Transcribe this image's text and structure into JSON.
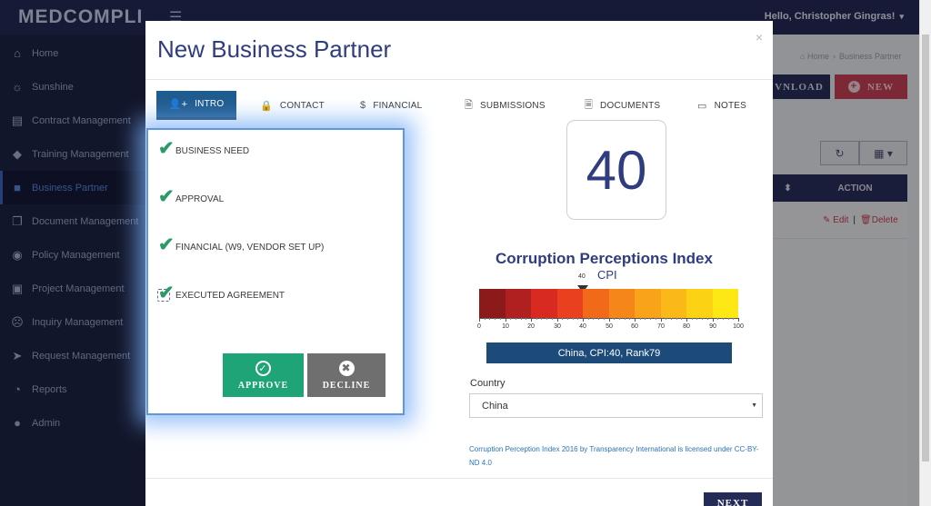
{
  "app": {
    "logo": "MEDCOMPLI",
    "greeting": "Hello, Christopher Gingras!",
    "sidebar": [
      {
        "label": "Home",
        "icon": "home-icon"
      },
      {
        "label": "Sunshine",
        "icon": "sun-icon"
      },
      {
        "label": "Contract Management",
        "icon": "document-icon"
      },
      {
        "label": "Training Management",
        "icon": "graduation-cap-icon"
      },
      {
        "label": "Business Partner",
        "icon": "briefcase-icon",
        "active": true
      },
      {
        "label": "Document Management",
        "icon": "copy-icon"
      },
      {
        "label": "Policy Management",
        "icon": "eye-icon"
      },
      {
        "label": "Project Management",
        "icon": "picture-icon"
      },
      {
        "label": "Inquiry Management",
        "icon": "frown-icon"
      },
      {
        "label": "Request Management",
        "icon": "send-icon"
      },
      {
        "label": "Reports",
        "icon": "pie-chart-icon"
      },
      {
        "label": "Admin",
        "icon": "user-icon"
      }
    ],
    "breadcrumb": {
      "home": "Home",
      "current": "Business Partner"
    },
    "download_label": "VNLOAD",
    "new_label": "NEW",
    "table": {
      "action_header": "ACTION",
      "edit": "Edit",
      "delete": "Delete"
    }
  },
  "modal": {
    "title": "New Business Partner",
    "close": "×",
    "tabs": [
      {
        "label": "INTRO",
        "icon": "user-plus-icon",
        "active": true
      },
      {
        "label": "CONTACT",
        "icon": "lock-icon"
      },
      {
        "label": "FINANCIAL",
        "icon": "dollar-icon"
      },
      {
        "label": "SUBMISSIONS",
        "icon": "file-icon"
      },
      {
        "label": "DOCUMENTS",
        "icon": "file-text-icon"
      },
      {
        "label": "NOTES",
        "icon": "note-icon"
      }
    ],
    "checklist": [
      {
        "label": "BUSINESS NEED",
        "checked": true
      },
      {
        "label": "APPROVAL",
        "checked": true
      },
      {
        "label": "FINANCIAL (W9, VENDOR SET UP)",
        "checked": true
      },
      {
        "label": "EXECUTED AGREEMENT",
        "checked": true
      }
    ],
    "approve_label": "APPROVE",
    "decline_label": "DECLINE",
    "score": "40",
    "cpi": {
      "title": "Corruption Perceptions Index",
      "label": "CPI",
      "value": 40,
      "marker_label": "40",
      "scale_min": 0,
      "scale_max": 100,
      "ticks": [
        "0",
        "10",
        "20",
        "30",
        "40",
        "50",
        "60",
        "70",
        "80",
        "90",
        "100"
      ],
      "colors": [
        "#8c1a1a",
        "#b02020",
        "#d92a22",
        "#e9411f",
        "#f06a1a",
        "#f5861a",
        "#f8a31a",
        "#fab918",
        "#fcd215",
        "#fde714"
      ],
      "banner": "China, CPI:40, Rank79"
    },
    "country_label": "Country",
    "country_value": "China",
    "license_text": "Corruption Perception Index 2016 by Transparency International is licensed under CC-BY-ND 4.0",
    "next_label": "NEXT"
  }
}
